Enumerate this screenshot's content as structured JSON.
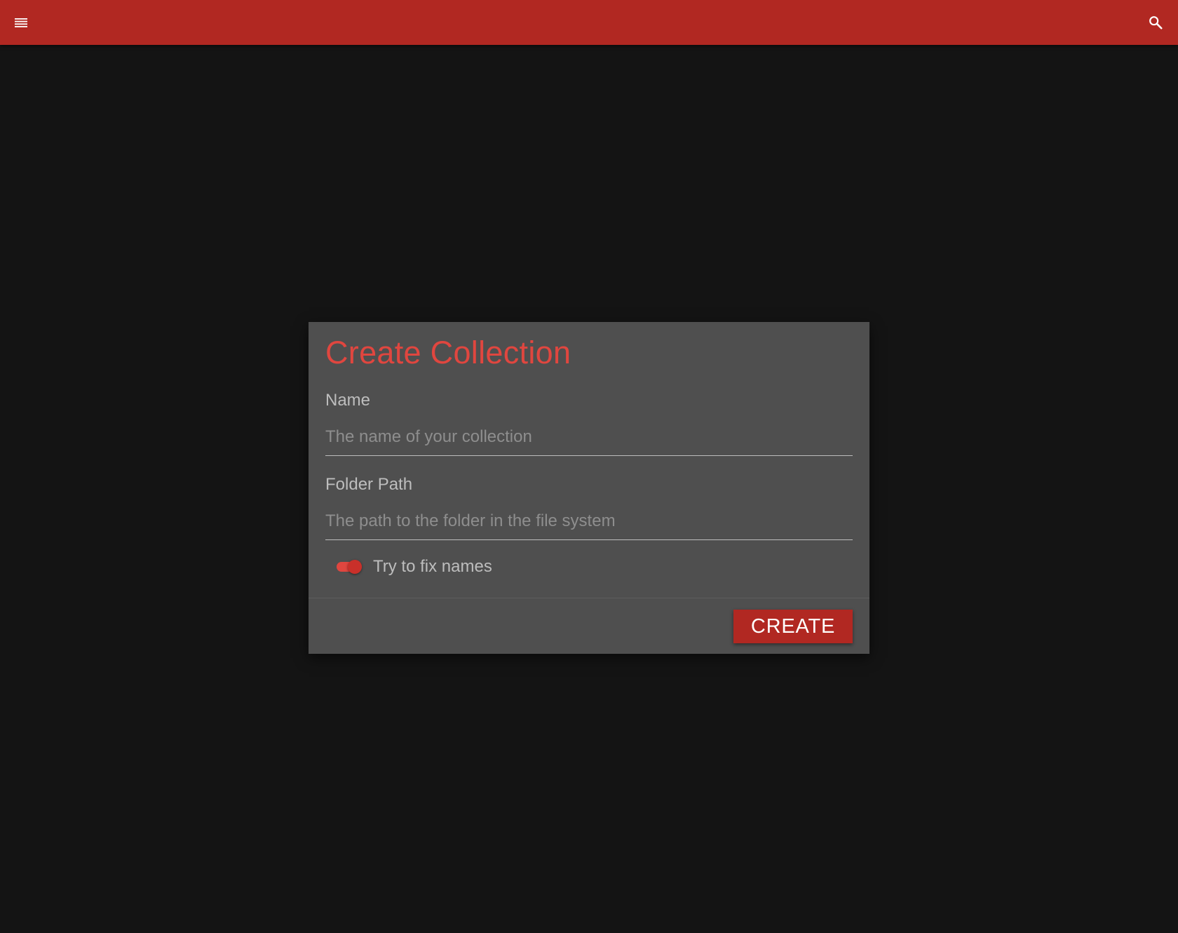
{
  "app": {
    "accent_color": "#b12822",
    "background_color": "#141414"
  },
  "header": {
    "menu_icon": "menu-icon",
    "search_icon": "search-icon"
  },
  "dialog": {
    "title": "Create Collection",
    "title_color": "#e0463f",
    "fields": [
      {
        "label": "Name",
        "placeholder": "The name of your collection",
        "value": ""
      },
      {
        "label": "Folder Path",
        "placeholder": "The path to the folder in the file system",
        "value": ""
      }
    ],
    "toggle": {
      "label": "Try to fix names",
      "checked": true
    },
    "create_label": "CREATE"
  }
}
